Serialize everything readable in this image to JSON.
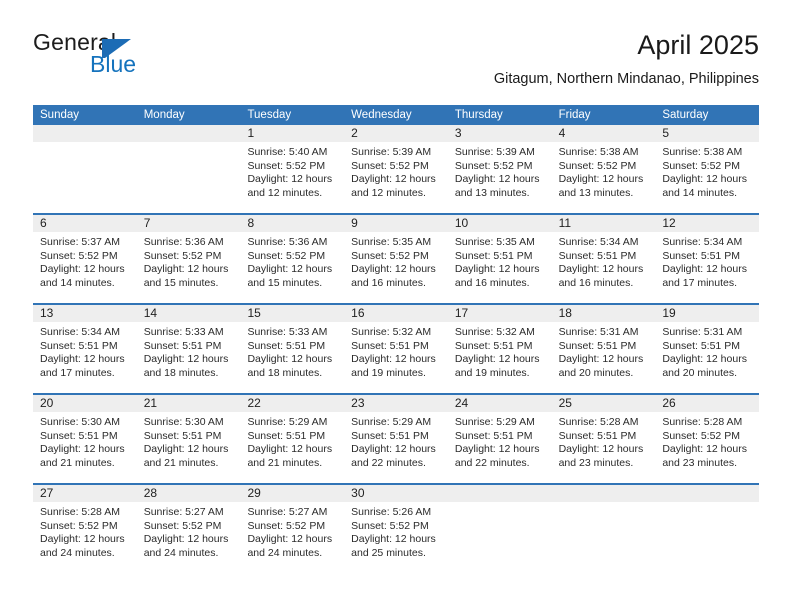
{
  "brand": {
    "name_top": "General",
    "name_bottom": "Blue",
    "accent_color": "#1c6cb5"
  },
  "header": {
    "month_title": "April 2025",
    "location": "Gitagum, Northern Mindanao, Philippines"
  },
  "calendar": {
    "header_bg": "#3174b6",
    "daynum_bg": "#eeeeee",
    "weekdays": [
      "Sunday",
      "Monday",
      "Tuesday",
      "Wednesday",
      "Thursday",
      "Friday",
      "Saturday"
    ],
    "weeks": [
      [
        {
          "day": "",
          "lines": []
        },
        {
          "day": "",
          "lines": []
        },
        {
          "day": "1",
          "lines": [
            "Sunrise: 5:40 AM",
            "Sunset: 5:52 PM",
            "Daylight: 12 hours",
            "and 12 minutes."
          ]
        },
        {
          "day": "2",
          "lines": [
            "Sunrise: 5:39 AM",
            "Sunset: 5:52 PM",
            "Daylight: 12 hours",
            "and 12 minutes."
          ]
        },
        {
          "day": "3",
          "lines": [
            "Sunrise: 5:39 AM",
            "Sunset: 5:52 PM",
            "Daylight: 12 hours",
            "and 13 minutes."
          ]
        },
        {
          "day": "4",
          "lines": [
            "Sunrise: 5:38 AM",
            "Sunset: 5:52 PM",
            "Daylight: 12 hours",
            "and 13 minutes."
          ]
        },
        {
          "day": "5",
          "lines": [
            "Sunrise: 5:38 AM",
            "Sunset: 5:52 PM",
            "Daylight: 12 hours",
            "and 14 minutes."
          ]
        }
      ],
      [
        {
          "day": "6",
          "lines": [
            "Sunrise: 5:37 AM",
            "Sunset: 5:52 PM",
            "Daylight: 12 hours",
            "and 14 minutes."
          ]
        },
        {
          "day": "7",
          "lines": [
            "Sunrise: 5:36 AM",
            "Sunset: 5:52 PM",
            "Daylight: 12 hours",
            "and 15 minutes."
          ]
        },
        {
          "day": "8",
          "lines": [
            "Sunrise: 5:36 AM",
            "Sunset: 5:52 PM",
            "Daylight: 12 hours",
            "and 15 minutes."
          ]
        },
        {
          "day": "9",
          "lines": [
            "Sunrise: 5:35 AM",
            "Sunset: 5:52 PM",
            "Daylight: 12 hours",
            "and 16 minutes."
          ]
        },
        {
          "day": "10",
          "lines": [
            "Sunrise: 5:35 AM",
            "Sunset: 5:51 PM",
            "Daylight: 12 hours",
            "and 16 minutes."
          ]
        },
        {
          "day": "11",
          "lines": [
            "Sunrise: 5:34 AM",
            "Sunset: 5:51 PM",
            "Daylight: 12 hours",
            "and 16 minutes."
          ]
        },
        {
          "day": "12",
          "lines": [
            "Sunrise: 5:34 AM",
            "Sunset: 5:51 PM",
            "Daylight: 12 hours",
            "and 17 minutes."
          ]
        }
      ],
      [
        {
          "day": "13",
          "lines": [
            "Sunrise: 5:34 AM",
            "Sunset: 5:51 PM",
            "Daylight: 12 hours",
            "and 17 minutes."
          ]
        },
        {
          "day": "14",
          "lines": [
            "Sunrise: 5:33 AM",
            "Sunset: 5:51 PM",
            "Daylight: 12 hours",
            "and 18 minutes."
          ]
        },
        {
          "day": "15",
          "lines": [
            "Sunrise: 5:33 AM",
            "Sunset: 5:51 PM",
            "Daylight: 12 hours",
            "and 18 minutes."
          ]
        },
        {
          "day": "16",
          "lines": [
            "Sunrise: 5:32 AM",
            "Sunset: 5:51 PM",
            "Daylight: 12 hours",
            "and 19 minutes."
          ]
        },
        {
          "day": "17",
          "lines": [
            "Sunrise: 5:32 AM",
            "Sunset: 5:51 PM",
            "Daylight: 12 hours",
            "and 19 minutes."
          ]
        },
        {
          "day": "18",
          "lines": [
            "Sunrise: 5:31 AM",
            "Sunset: 5:51 PM",
            "Daylight: 12 hours",
            "and 20 minutes."
          ]
        },
        {
          "day": "19",
          "lines": [
            "Sunrise: 5:31 AM",
            "Sunset: 5:51 PM",
            "Daylight: 12 hours",
            "and 20 minutes."
          ]
        }
      ],
      [
        {
          "day": "20",
          "lines": [
            "Sunrise: 5:30 AM",
            "Sunset: 5:51 PM",
            "Daylight: 12 hours",
            "and 21 minutes."
          ]
        },
        {
          "day": "21",
          "lines": [
            "Sunrise: 5:30 AM",
            "Sunset: 5:51 PM",
            "Daylight: 12 hours",
            "and 21 minutes."
          ]
        },
        {
          "day": "22",
          "lines": [
            "Sunrise: 5:29 AM",
            "Sunset: 5:51 PM",
            "Daylight: 12 hours",
            "and 21 minutes."
          ]
        },
        {
          "day": "23",
          "lines": [
            "Sunrise: 5:29 AM",
            "Sunset: 5:51 PM",
            "Daylight: 12 hours",
            "and 22 minutes."
          ]
        },
        {
          "day": "24",
          "lines": [
            "Sunrise: 5:29 AM",
            "Sunset: 5:51 PM",
            "Daylight: 12 hours",
            "and 22 minutes."
          ]
        },
        {
          "day": "25",
          "lines": [
            "Sunrise: 5:28 AM",
            "Sunset: 5:51 PM",
            "Daylight: 12 hours",
            "and 23 minutes."
          ]
        },
        {
          "day": "26",
          "lines": [
            "Sunrise: 5:28 AM",
            "Sunset: 5:52 PM",
            "Daylight: 12 hours",
            "and 23 minutes."
          ]
        }
      ],
      [
        {
          "day": "27",
          "lines": [
            "Sunrise: 5:28 AM",
            "Sunset: 5:52 PM",
            "Daylight: 12 hours",
            "and 24 minutes."
          ]
        },
        {
          "day": "28",
          "lines": [
            "Sunrise: 5:27 AM",
            "Sunset: 5:52 PM",
            "Daylight: 12 hours",
            "and 24 minutes."
          ]
        },
        {
          "day": "29",
          "lines": [
            "Sunrise: 5:27 AM",
            "Sunset: 5:52 PM",
            "Daylight: 12 hours",
            "and 24 minutes."
          ]
        },
        {
          "day": "30",
          "lines": [
            "Sunrise: 5:26 AM",
            "Sunset: 5:52 PM",
            "Daylight: 12 hours",
            "and 25 minutes."
          ]
        },
        {
          "day": "",
          "lines": []
        },
        {
          "day": "",
          "lines": []
        },
        {
          "day": "",
          "lines": []
        }
      ]
    ]
  }
}
